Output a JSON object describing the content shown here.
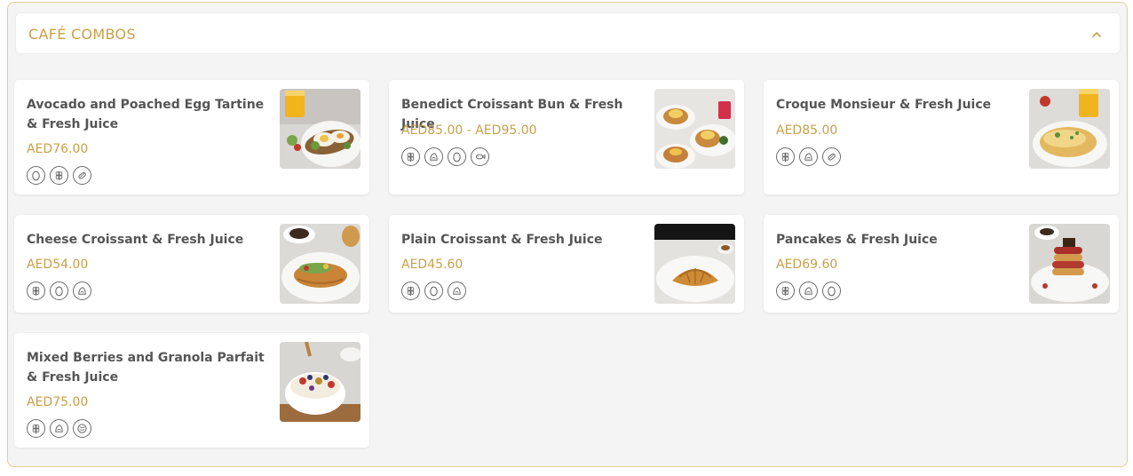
{
  "section": {
    "title": "CAFÉ COMBOS"
  },
  "items": [
    {
      "name": "Avocado and Poached Egg Tartine & Fresh Juice",
      "price": "AED76.00",
      "icons": [
        "egg-icon",
        "wheat-icon",
        "soy-icon"
      ]
    },
    {
      "name": "Benedict Croissant Bun & Fresh Juice",
      "price": "AED85.00 - AED95.00",
      "icons": [
        "wheat-icon",
        "milk-icon",
        "egg-icon",
        "fish-icon"
      ]
    },
    {
      "name": "Croque Monsieur & Fresh Juice",
      "price": "AED85.00",
      "icons": [
        "wheat-icon",
        "milk-icon",
        "soy-icon"
      ]
    },
    {
      "name": "Cheese Croissant & Fresh Juice",
      "price": "AED54.00",
      "icons": [
        "wheat-icon",
        "egg-icon",
        "milk-icon"
      ]
    },
    {
      "name": "Plain Croissant & Fresh Juice",
      "price": "AED45.60",
      "icons": [
        "wheat-icon",
        "egg-icon",
        "milk-icon"
      ]
    },
    {
      "name": "Pancakes & Fresh Juice",
      "price": "AED69.60",
      "icons": [
        "wheat-icon",
        "milk-icon",
        "egg-icon"
      ]
    },
    {
      "name": "Mixed Berries and Granola Parfait & Fresh Juice",
      "price": "AED75.00",
      "icons": [
        "wheat-icon",
        "milk-icon",
        "nut-icon"
      ]
    }
  ],
  "colors": {
    "accent": "#c9a04a",
    "border": "#e2cf9d",
    "background": "#f4f4f5"
  }
}
